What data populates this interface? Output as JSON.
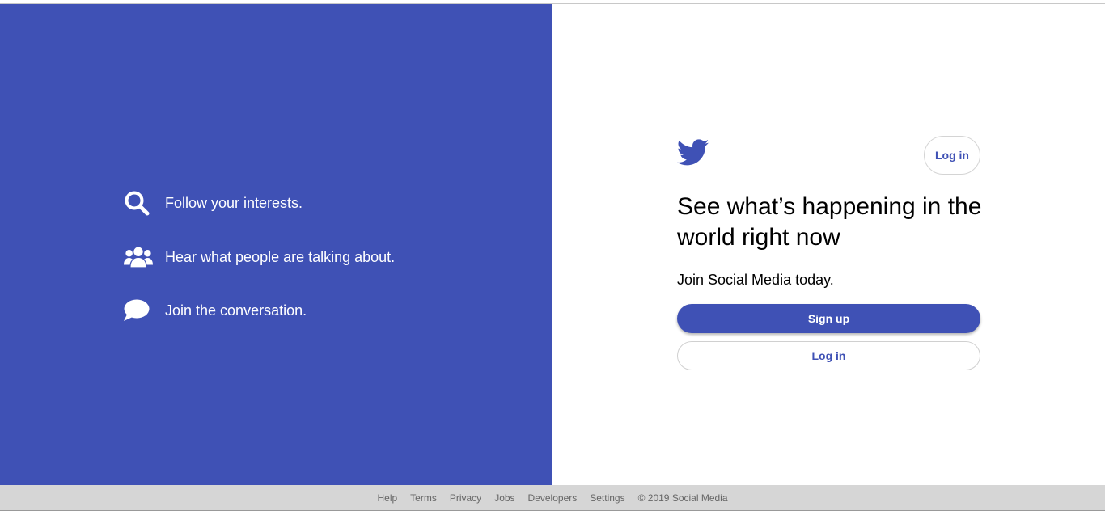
{
  "colors": {
    "brand": "#3f51b5",
    "footer_bg": "#d6d6d6",
    "text": "#000000"
  },
  "features": [
    {
      "icon": "search-icon",
      "text": "Follow your interests."
    },
    {
      "icon": "users-icon",
      "text": "Hear what people are talking about."
    },
    {
      "icon": "chat-bubble-icon",
      "text": "Join the conversation."
    }
  ],
  "header": {
    "logo_icon": "bird-icon",
    "login_label": "Log in"
  },
  "main": {
    "headline": "See what’s happening in the world right now",
    "join_text": "Join Social Media today.",
    "signup_label": "Sign up",
    "login_label": "Log in"
  },
  "footer": {
    "links": [
      "Help",
      "Terms",
      "Privacy",
      "Jobs",
      "Developers",
      "Settings"
    ],
    "copyright": "© 2019 Social Media"
  }
}
